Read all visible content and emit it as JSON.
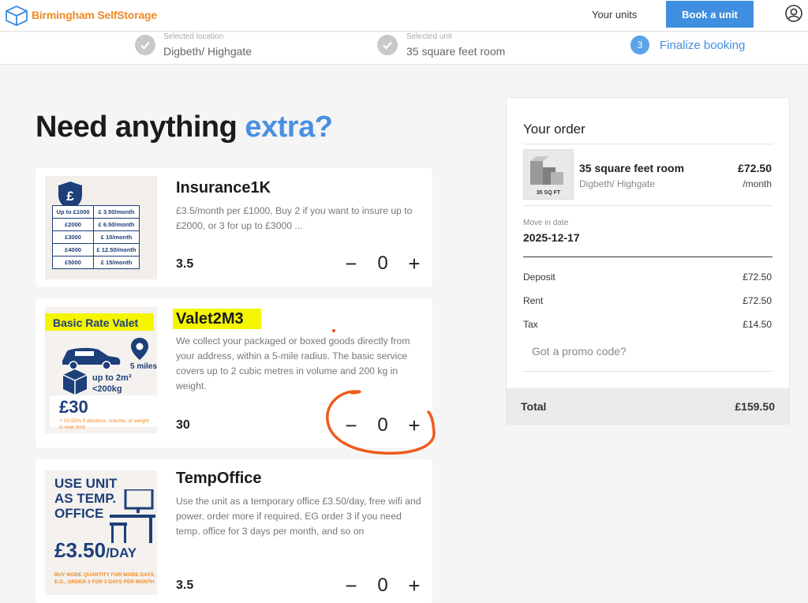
{
  "header": {
    "brand": "Birmingham SelfStorage",
    "your_units": "Your units",
    "book_unit": "Book a unit",
    "icons": {
      "logo": "box-icon",
      "account": "user-circle-icon"
    }
  },
  "steps": [
    {
      "label": "Selected location",
      "value": "Digbeth/ Highgate",
      "state": "done"
    },
    {
      "label": "Selected unit",
      "value": "35 square feet room",
      "state": "done"
    },
    {
      "number": "3",
      "value": "Finalize booking",
      "state": "active"
    }
  ],
  "heading": {
    "text": "Need anything",
    "accent": "extra?"
  },
  "addons": [
    {
      "title": "Insurance1K",
      "description": "£3.5/month per £1000, Buy 2 if you want to insure up to £2000, or 3 for up to £3000 ...",
      "price": "3.5",
      "quantity": "0",
      "image": {
        "rows": [
          [
            "Up to £1000",
            "£ 3.50/month"
          ],
          [
            "£2000",
            "£ 6.50/month"
          ],
          [
            "£3000",
            "£ 10/month"
          ],
          [
            "£4000",
            "£ 12.50/month"
          ],
          [
            "£5000",
            "£ 15/month"
          ]
        ]
      }
    },
    {
      "title": "Valet2M3",
      "description": "We collect your packaged or boxed goods directly from your address, within a 5-mile radius. The basic service covers up to 2 cubic metres in volume and 200 kg in weight.",
      "price": "30",
      "quantity": "0",
      "image": {
        "banner": "Basic Rate Valet",
        "miles": "5 miles",
        "capacity1": "up to 2m³",
        "capacity2": "<200kg",
        "price": "£30",
        "note": "+ 20-50% if distance, volume, or weight is over limit"
      }
    },
    {
      "title": "TempOffice",
      "description": "Use the unit as a temporary office £3.50/day, free wifi and power, order more if required, EG order 3 if you need temp. office for 3 days per month, and so on",
      "price": "3.5",
      "quantity": "0",
      "image": {
        "line1": "USE UNIT",
        "line2": "AS TEMP.",
        "line3": "OFFICE",
        "price": "£3.50",
        "per": "/DAY",
        "note1": "BUY MORE QUANTITY FOR MORE DAYS,",
        "note2": "E.G., ORDER 3 FOR 3 DAYS PER MONTH"
      }
    }
  ],
  "qty_controls": {
    "minus": "−",
    "plus": "+"
  },
  "order": {
    "title": "Your order",
    "unit_name": "35 square feet room",
    "unit_location": "Digbeth/ Highgate",
    "unit_price": "£72.50",
    "unit_period": "/month",
    "thumb_label": "35 SQ FT",
    "move_in_label": "Move in date",
    "move_in_date": "2025-12-17",
    "rows": [
      {
        "label": "Deposit",
        "value": "£72.50"
      },
      {
        "label": "Rent",
        "value": "£72.50"
      },
      {
        "label": "Tax",
        "value": "£14.50"
      }
    ],
    "promo": "Got a promo code?",
    "total_label": "Total",
    "total_value": "£159.50"
  },
  "colors": {
    "brand_orange": "#f08a24",
    "primary_blue": "#3f8fe0",
    "annotation_orange": "#f05a1a",
    "highlight_yellow": "#f5f500"
  }
}
